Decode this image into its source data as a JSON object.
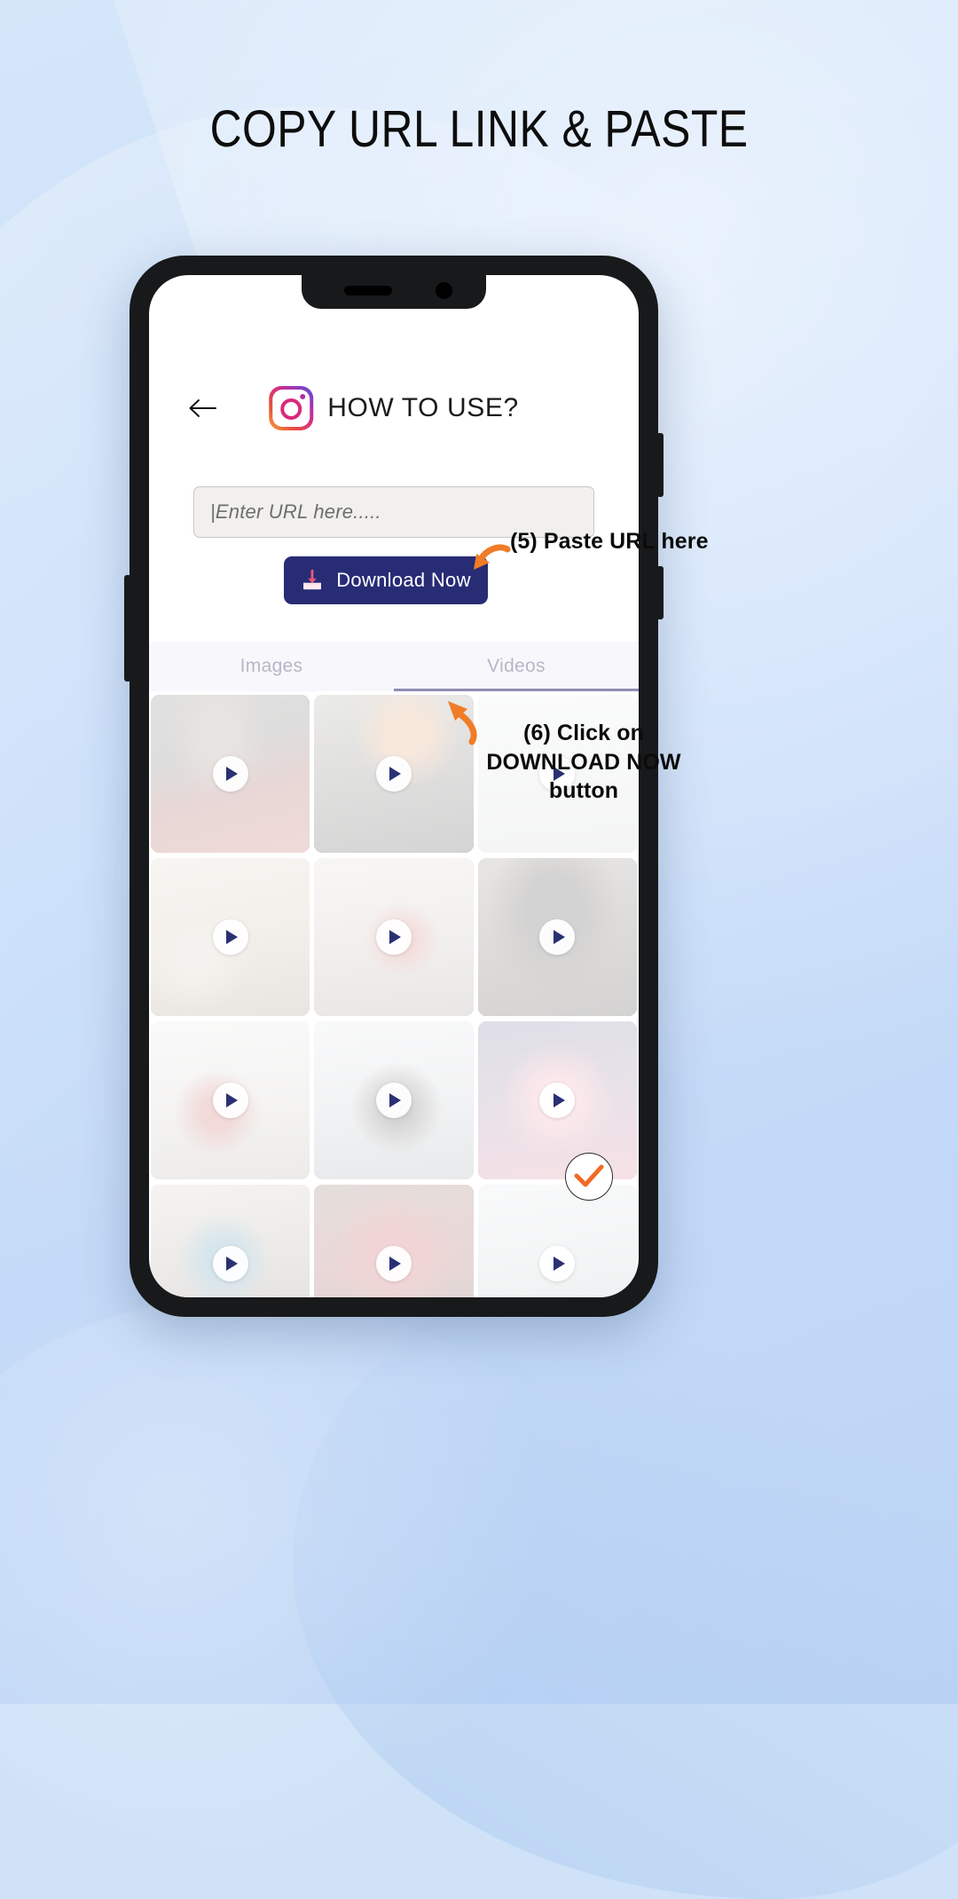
{
  "headline": "COPY URL LINK & PASTE",
  "app": {
    "header": {
      "back_icon": "back-arrow-icon",
      "logo_icon": "instagram-logo-icon",
      "title": "HOW TO USE?"
    },
    "url_field": {
      "placeholder": "|Enter URL here....."
    },
    "download_button": {
      "label": "Download Now",
      "icon": "download-tray-icon",
      "color": "#272c75"
    },
    "tabs": [
      {
        "label": "Images",
        "active": false
      },
      {
        "label": "Videos",
        "active": true
      }
    ],
    "grid": {
      "items": [
        {
          "play_icon": "play-icon"
        },
        {
          "play_icon": "play-icon"
        },
        {
          "play_icon": "play-icon"
        },
        {
          "play_icon": "play-icon"
        },
        {
          "play_icon": "play-icon"
        },
        {
          "play_icon": "play-icon"
        },
        {
          "play_icon": "play-icon"
        },
        {
          "play_icon": "play-icon"
        },
        {
          "play_icon": "play-icon"
        },
        {
          "play_icon": "play-icon"
        },
        {
          "play_icon": "play-icon"
        },
        {
          "play_icon": "play-icon"
        }
      ]
    }
  },
  "annotations": {
    "step5": {
      "text": "(5) Paste URL here",
      "arrow_icon": "curved-arrow-left-icon",
      "color": "#f07c28"
    },
    "step6": {
      "text": "(6) Click on DOWNLOAD NOW button",
      "arrow_icon": "curved-arrow-up-icon",
      "color": "#f07c28"
    },
    "check": {
      "icon": "check-mark-icon",
      "color": "#f07c28"
    }
  }
}
